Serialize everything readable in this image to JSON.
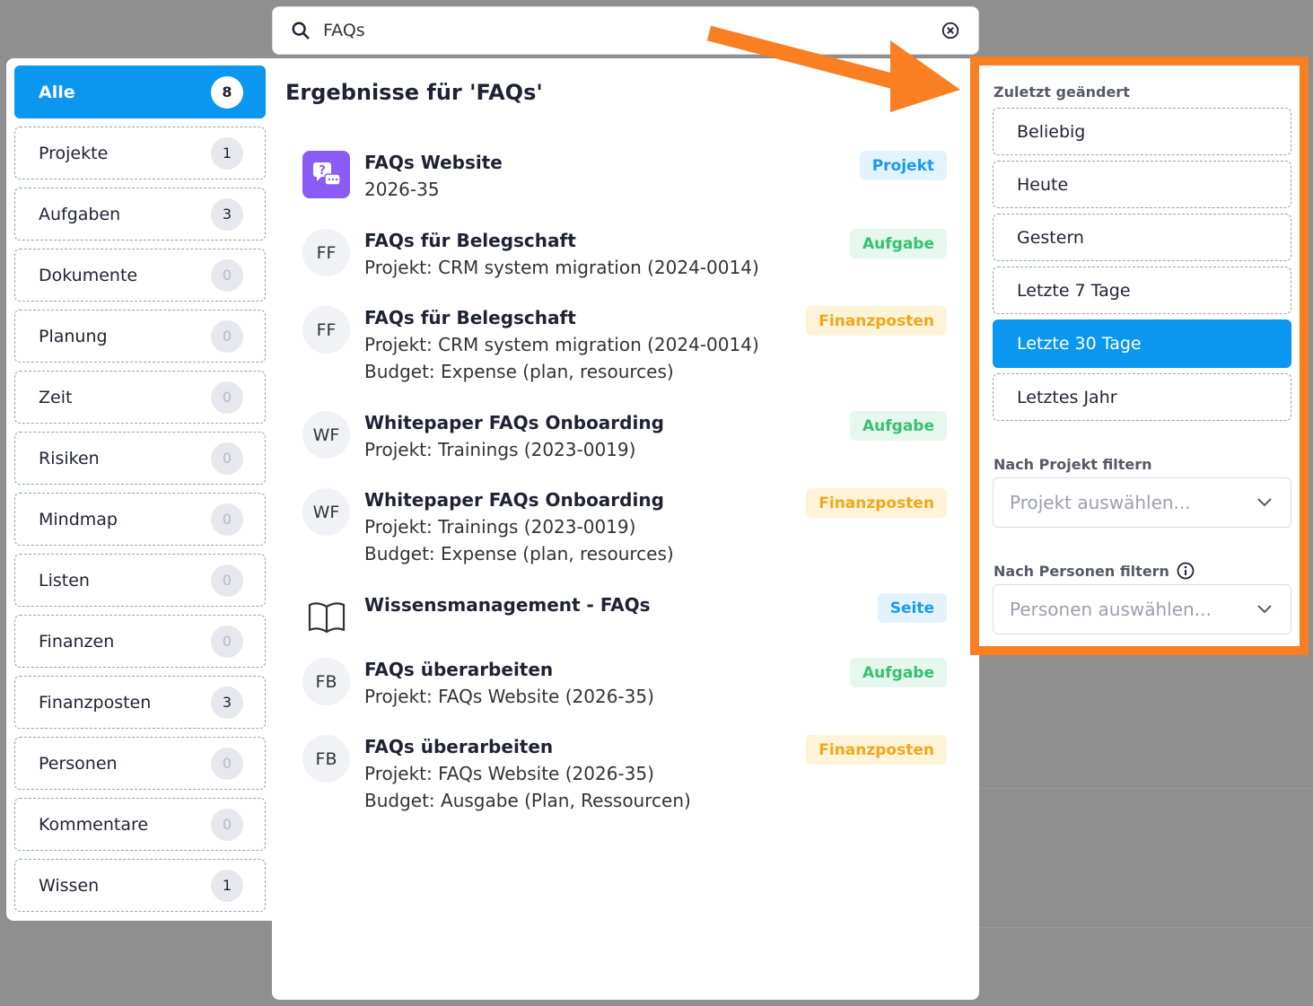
{
  "search": {
    "value": "FAQs",
    "placeholder": ""
  },
  "categories": [
    {
      "label": "Alle",
      "count": "8",
      "active": true
    },
    {
      "label": "Projekte",
      "count": "1"
    },
    {
      "label": "Aufgaben",
      "count": "3"
    },
    {
      "label": "Dokumente",
      "count": "0"
    },
    {
      "label": "Planung",
      "count": "0"
    },
    {
      "label": "Zeit",
      "count": "0"
    },
    {
      "label": "Risiken",
      "count": "0"
    },
    {
      "label": "Mindmap",
      "count": "0"
    },
    {
      "label": "Listen",
      "count": "0"
    },
    {
      "label": "Finanzen",
      "count": "0"
    },
    {
      "label": "Finanzposten",
      "count": "3"
    },
    {
      "label": "Personen",
      "count": "0"
    },
    {
      "label": "Kommentare",
      "count": "0"
    },
    {
      "label": "Wissen",
      "count": "1"
    }
  ],
  "results": {
    "title": "Ergebnisse für 'FAQs'",
    "items": [
      {
        "avatar": "faq-icon",
        "title": "FAQs Website",
        "lines": [
          "2026-35"
        ],
        "tag": "Projekt",
        "tag_color": "#1a9aed"
      },
      {
        "avatar": "FF",
        "title": "FAQs für Belegschaft",
        "lines": [
          "Projekt: CRM system migration (2024-0014)"
        ],
        "tag": "Aufgabe",
        "tag_color": "#36c072"
      },
      {
        "avatar": "FF",
        "title": "FAQs für Belegschaft",
        "lines": [
          "Projekt: CRM system migration (2024-0014)",
          "Budget: Expense (plan, resources)"
        ],
        "tag": "Finanzposten",
        "tag_color": "#f1a71b"
      },
      {
        "avatar": "WF",
        "title": "Whitepaper FAQs Onboarding",
        "lines": [
          "Projekt: Trainings (2023-0019)"
        ],
        "tag": "Aufgabe",
        "tag_color": "#36c072"
      },
      {
        "avatar": "WF",
        "title": "Whitepaper FAQs Onboarding",
        "lines": [
          "Projekt: Trainings (2023-0019)",
          "Budget: Expense (plan, resources)"
        ],
        "tag": "Finanzposten",
        "tag_color": "#f1a71b"
      },
      {
        "avatar": "book-icon",
        "title": "Wissensmanagement - FAQs",
        "lines": [],
        "tag": "Seite",
        "tag_color": "#1a9aed"
      },
      {
        "avatar": "FB",
        "title": "FAQs überarbeiten",
        "lines": [
          "Projekt: FAQs Website (2026-35)"
        ],
        "tag": "Aufgabe",
        "tag_color": "#36c072"
      },
      {
        "avatar": "FB",
        "title": "FAQs überarbeiten",
        "lines": [
          "Projekt: FAQs Website (2026-35)",
          "Budget: Ausgabe (Plan, Ressourcen)"
        ],
        "tag": "Finanzposten",
        "tag_color": "#f1a71b"
      }
    ]
  },
  "filters": {
    "modified_label": "Zuletzt geändert",
    "options": [
      "Beliebig",
      "Heute",
      "Gestern",
      "Letzte 7 Tage",
      "Letzte 30 Tage",
      "Letztes Jahr"
    ],
    "selected": "Letzte 30 Tage",
    "project_label": "Nach Projekt filtern",
    "project_placeholder": "Projekt auswählen...",
    "people_label": "Nach Personen filtern",
    "people_placeholder": "Personen auswählen..."
  },
  "colors": {
    "accent": "#0b97f0",
    "highlight": "#f97f22"
  }
}
